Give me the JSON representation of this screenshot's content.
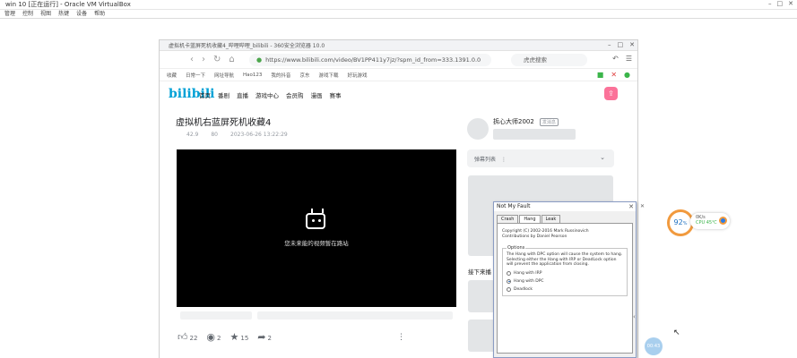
{
  "host": {
    "title": "win 10 [正在运行] - Oracle VM VirtualBox",
    "menu": [
      "管理",
      "控制",
      "视图",
      "热键",
      "设备",
      "帮助"
    ]
  },
  "browser": {
    "tab_title": "虚拟机卡蓝屏死机收藏4_哔哩哔哩_bilibili - 360安全浏览器 10.0",
    "url": "https://www.bilibili.com/video/BV1PP411y7jz/?spm_id_from=333.1391.0.0",
    "search_placeholder": "虎虎搜索",
    "bookmarks": [
      "收藏",
      "日常一下",
      "网址导航",
      "Hao123",
      "我的抖音",
      "京东",
      "游戏下载",
      "好玩游戏"
    ]
  },
  "bili": {
    "logo": "bilibili",
    "nav": [
      "首页",
      "番剧",
      "直播",
      "游戏中心",
      "会员购",
      "漫画",
      "赛事"
    ],
    "video_title": "虚拟机右蓝屏死机收藏4",
    "views": "42.9",
    "danmaku_count": "80",
    "date": "2023-06-26 13:22:29",
    "player_message": "您未来能的视频暂在路站",
    "actions": {
      "likes": "22",
      "coins": "2",
      "favorites": "15",
      "shares": "2"
    },
    "up_name": "拆心大师2002",
    "up_tag": "发消息",
    "danmaku_list_label": "弹幕列表",
    "next_label": "接下来播"
  },
  "nmf": {
    "title": "Not My Fault",
    "tabs": [
      "Crash",
      "Hang",
      "Leak"
    ],
    "copyright_1": "Copyright (C) 2002-2016 Mark Russinovich",
    "copyright_2": "Contributions by Daniel Pearson",
    "options_legend": "Options",
    "desc": "The Hang with DPC option will cause the system to hang. Selecting either the Hang with IRP or DeadLock option will prevent the application from closing.",
    "opt_irp": "Hang with IRP",
    "opt_dpc": "Hang with DPC",
    "opt_deadlock": "Deadlock"
  },
  "widget": {
    "percent": "92",
    "percent_sign": "%",
    "speed": "0K/s",
    "cpu": "CPU 45℃",
    "assist": "00:43"
  }
}
